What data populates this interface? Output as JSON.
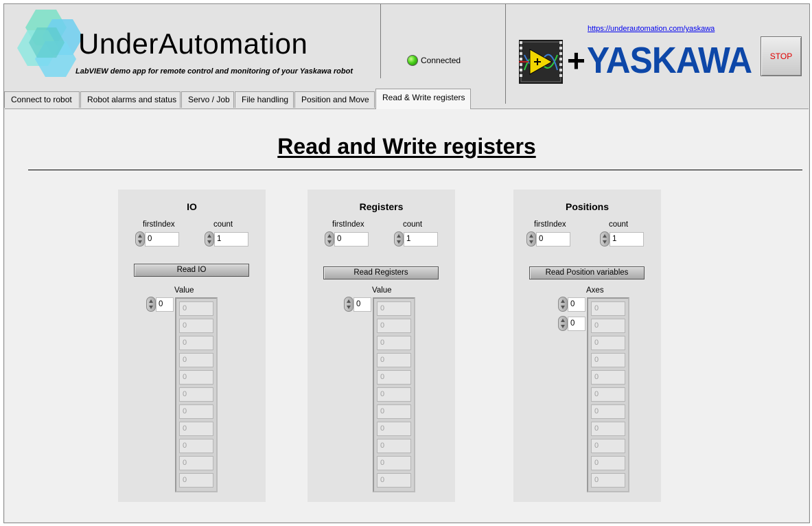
{
  "header": {
    "brand_name": "UnderAutomation",
    "subtitle": "LabVIEW demo app for remote control and monitoring of your Yaskawa robot",
    "status_label": "Connected",
    "link_text": "https://underautomation.com/yaskawa",
    "partner_plus": "+",
    "partner_name": "YASKAWA",
    "stop_label": "STOP"
  },
  "tabs": [
    {
      "label": "Connect to robot"
    },
    {
      "label": "Robot alarms and status"
    },
    {
      "label": "Servo / Job"
    },
    {
      "label": "File handling"
    },
    {
      "label": "Position and Move"
    },
    {
      "label": "Read & Write registers"
    }
  ],
  "active_tab": "Read & Write registers",
  "page": {
    "heading": "Read and Write registers"
  },
  "groups": {
    "io": {
      "title": "IO",
      "first_index_label": "firstIndex",
      "first_index_value": "0",
      "count_label": "count",
      "count_value": "1",
      "button_label": "Read IO",
      "array_label": "Value",
      "array_index": "0",
      "values": [
        "0",
        "0",
        "0",
        "0",
        "0",
        "0",
        "0",
        "0",
        "0",
        "0",
        "0"
      ]
    },
    "registers": {
      "title": "Registers",
      "first_index_label": "firstIndex",
      "first_index_value": "0",
      "count_label": "count",
      "count_value": "1",
      "button_label": "Read Registers",
      "array_label": "Value",
      "array_index": "0",
      "values": [
        "0",
        "0",
        "0",
        "0",
        "0",
        "0",
        "0",
        "0",
        "0",
        "0",
        "0"
      ]
    },
    "positions": {
      "title": "Positions",
      "first_index_label": "firstIndex",
      "first_index_value": "0",
      "count_label": "count",
      "count_value": "1",
      "button_label": "Read Position variables",
      "array_label": "Axes",
      "array_index_row": "0",
      "array_index_col": "0",
      "values": [
        "0",
        "0",
        "0",
        "0",
        "0",
        "0",
        "0",
        "0",
        "0",
        "0",
        "0"
      ]
    }
  },
  "colors": {
    "link": "#0000ee",
    "yaskawa_blue": "#0d47a8",
    "stop_text": "#e00000",
    "status_led": "#49d11a"
  }
}
